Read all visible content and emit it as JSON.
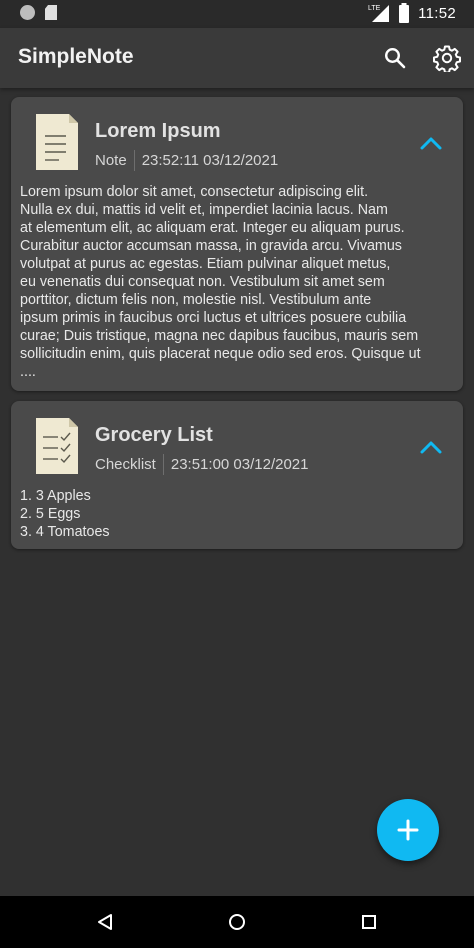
{
  "status_bar": {
    "network_label": "LTE",
    "time": "11:52"
  },
  "app_bar": {
    "title": "SimpleNote",
    "icons": [
      "search-icon",
      "gear-icon"
    ]
  },
  "notes": [
    {
      "title": "Lorem Ipsum",
      "type": "Note",
      "timestamp": "23:52:11 03/12/2021",
      "icon": "note-document-icon",
      "body": "Lorem ipsum dolor sit amet, consectetur adipiscing elit.\nNulla ex dui, mattis id velit et, imperdiet lacinia lacus. Nam\nat elementum elit, ac aliquam erat. Integer eu aliquam purus.\nCurabitur auctor accumsan massa, in gravida arcu. Vivamus\nvolutpat at purus ac egestas. Etiam pulvinar aliquet metus,\neu venenatis dui consequat non. Vestibulum sit amet sem\nporttitor, dictum felis non, molestie nisl. Vestibulum ante\nipsum primis in faucibus orci luctus et ultrices posuere cubilia\ncurae; Duis tristique, magna nec dapibus faucibus, mauris sem\nsollicitudin enim, quis placerat neque odio sed eros. Quisque ut\n...."
    },
    {
      "title": "Grocery List",
      "type": "Checklist",
      "timestamp": "23:51:00 03/12/2021",
      "icon": "checklist-document-icon",
      "body": "1. 3 Apples\n2. 5 Eggs\n3. 4 Tomatoes"
    }
  ],
  "colors": {
    "background": "#303030",
    "app_bar": "#3a3a3a",
    "card": "#4a4a4a",
    "accent": "#10b9f2",
    "icon_paper": "#efe9d2"
  },
  "fab": {
    "icon": "plus-icon"
  },
  "nav_bar": {
    "icons": [
      "back-icon",
      "home-icon",
      "recents-icon"
    ]
  }
}
